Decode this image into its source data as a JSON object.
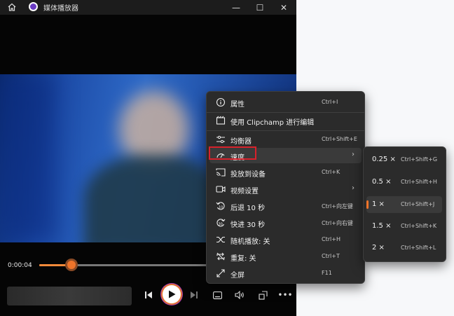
{
  "window": {
    "title": "媒体播放器",
    "caption_buttons": {
      "minimize": "—",
      "maximize": "☐",
      "close": "✕"
    }
  },
  "player": {
    "current_time": "0:00:04",
    "progress_fraction": 0.19
  },
  "context_menu": {
    "items": [
      {
        "label": "属性",
        "shortcut": "Ctrl+I",
        "icon": "info-icon",
        "submenu": false
      },
      {
        "label": "使用 Clipchamp 进行编辑",
        "shortcut": "",
        "icon": "clipchamp-icon",
        "submenu": false
      },
      {
        "label": "均衡器",
        "shortcut": "Ctrl+Shift+E",
        "icon": "equalizer-icon",
        "submenu": false
      },
      {
        "label": "速度",
        "shortcut": "",
        "icon": "speed-icon",
        "submenu": true
      },
      {
        "label": "投放到设备",
        "shortcut": "Ctrl+K",
        "icon": "cast-icon",
        "submenu": false
      },
      {
        "label": "视频设置",
        "shortcut": "",
        "icon": "video-settings-icon",
        "submenu": true
      },
      {
        "label": "后退 10 秒",
        "shortcut": "Ctrl+向左键",
        "icon": "rewind-10-icon",
        "submenu": false
      },
      {
        "label": "快进 30 秒",
        "shortcut": "Ctrl+向右键",
        "icon": "forward-30-icon",
        "submenu": false
      },
      {
        "label": "随机播放: 关",
        "shortcut": "Ctrl+H",
        "icon": "shuffle-icon",
        "submenu": false
      },
      {
        "label": "重复: 关",
        "shortcut": "Ctrl+T",
        "icon": "repeat-icon",
        "submenu": false
      },
      {
        "label": "全屏",
        "shortcut": "F11",
        "icon": "fullscreen-icon",
        "submenu": false
      }
    ]
  },
  "speed_submenu": {
    "items": [
      {
        "label": "0.25 ×",
        "shortcut": "Ctrl+Shift+G"
      },
      {
        "label": "0.5 ×",
        "shortcut": "Ctrl+Shift+H"
      },
      {
        "label": "1 ×",
        "shortcut": "Ctrl+Shift+J"
      },
      {
        "label": "1.5 ×",
        "shortcut": "Ctrl+Shift+K"
      },
      {
        "label": "2 ×",
        "shortcut": "Ctrl+Shift+L"
      }
    ],
    "selected": "1 ×"
  },
  "colors": {
    "accent": "#f0742a",
    "highlight_box": "#d8212b",
    "menu_bg": "#2b2b2b"
  }
}
